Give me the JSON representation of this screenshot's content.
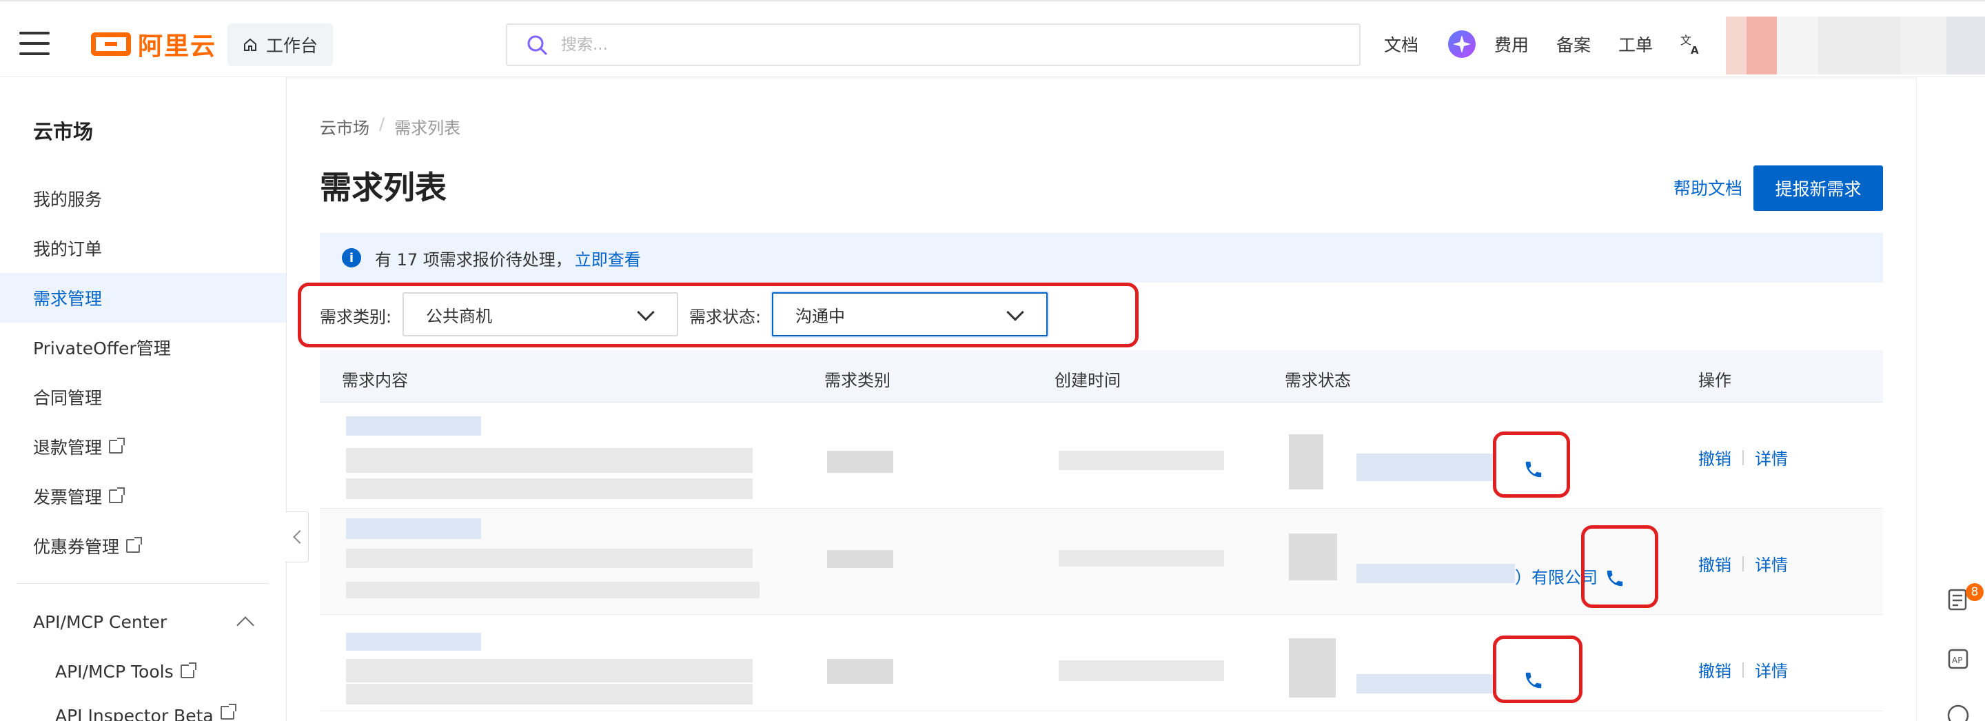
{
  "header": {
    "brand": "阿里云",
    "workbench_label": "工作台",
    "search_placeholder": "搜索...",
    "links": [
      "文档",
      "费用",
      "备案",
      "工单"
    ]
  },
  "sidebar": {
    "title": "云市场",
    "items": [
      {
        "label": "我的服务",
        "external": false
      },
      {
        "label": "我的订单",
        "external": false
      },
      {
        "label": "需求管理",
        "external": false,
        "active": true
      },
      {
        "label": "PrivateOffer管理",
        "external": false
      },
      {
        "label": "合同管理",
        "external": false
      },
      {
        "label": "退款管理",
        "external": true
      },
      {
        "label": "发票管理",
        "external": true
      },
      {
        "label": "优惠券管理",
        "external": true
      }
    ],
    "group": {
      "label": "API/MCP Center",
      "items": [
        {
          "label": "API/MCP Tools",
          "external": true
        },
        {
          "label": "API Inspector Beta",
          "external": true
        }
      ]
    }
  },
  "breadcrumb": [
    "云市场",
    "需求列表"
  ],
  "page": {
    "title": "需求列表",
    "help_link": "帮助文档",
    "primary_button": "提报新需求"
  },
  "notice": {
    "text": "有 17 项需求报价待处理，",
    "link": "立即查看"
  },
  "filters": {
    "category_label": "需求类别:",
    "category_value": "公共商机",
    "status_label": "需求状态:",
    "status_value": "沟通中"
  },
  "table": {
    "columns": [
      "需求内容",
      "需求类别",
      "创建时间",
      "需求状态",
      "操作"
    ],
    "row_actions": {
      "revoke": "撤销",
      "detail": "详情"
    },
    "company_suffix": "）有限公司"
  },
  "notifications": {
    "count": "8"
  },
  "colors": {
    "brand": "#ff6a00",
    "primary": "#0064c8",
    "highlight": "#e02020"
  }
}
